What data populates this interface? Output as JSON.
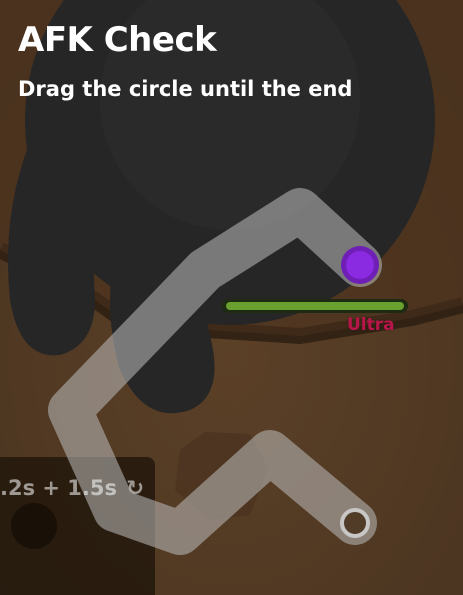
{
  "afk_check": {
    "title": "AFK Check",
    "instruction": "Drag the circle until the end",
    "drag_progress": 0
  },
  "mob_card": {
    "rarity": "Ultra",
    "rarity_color": "#b8164a",
    "health_bar_color": "#6aa02f",
    "health_fraction": 1.0
  },
  "cooldown_slot": {
    "text": ".2s + 1.5s",
    "icon": "refresh-icon",
    "icon_glyph": "↻"
  },
  "colors": {
    "ground": "#5a3f27",
    "mob_body": "#2a2a2a",
    "track": "#bdbdbd",
    "drag_handle": "#8a2be2",
    "end_target": "#bdbdbd"
  }
}
